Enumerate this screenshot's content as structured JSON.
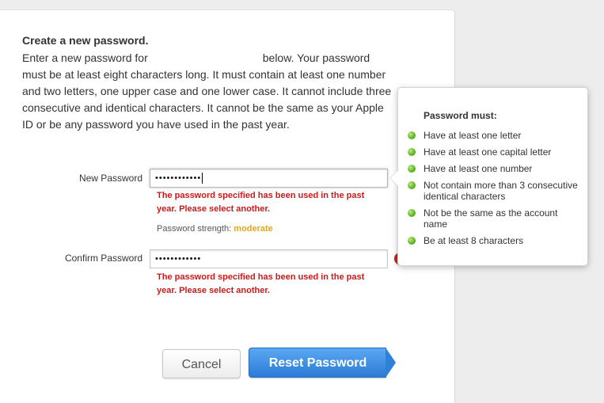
{
  "form": {
    "heading": "Create a new password.",
    "intro_part1": "Enter a new password for",
    "intro_part2": "below. Your password must be at least eight characters long. It must contain at least one number and two letters, one upper case and one lower case. It cannot include three consecutive and identical characters. It cannot be the same as your Apple ID or be any password you have used in the past year.",
    "new_password_label": "New Password",
    "new_password_value": "••••••••••••",
    "new_password_error": "The password specified has been used in the past year. Please select another.",
    "strength_label": "Password strength:",
    "strength_value": "moderate",
    "confirm_password_label": "Confirm Password",
    "confirm_password_value": "••••••••••••",
    "confirm_password_error": "The password specified has been used in the past year. Please select another.",
    "error_icon_glyph": "!"
  },
  "popover": {
    "title": "Password must:",
    "rules": [
      "Have at least one letter",
      "Have at least one capital letter",
      "Have at least one number",
      "Not contain more than 3 consecutive identical characters",
      "Not be the same as the account name",
      "Be at least 8 characters"
    ]
  },
  "buttons": {
    "cancel_label": "Cancel",
    "reset_label": "Reset Password"
  },
  "colors": {
    "error": "#cc1a1a",
    "strength_moderate": "#e2a81c",
    "primary_button": "#2b7bd6",
    "rule_ok": "#5fb325"
  }
}
